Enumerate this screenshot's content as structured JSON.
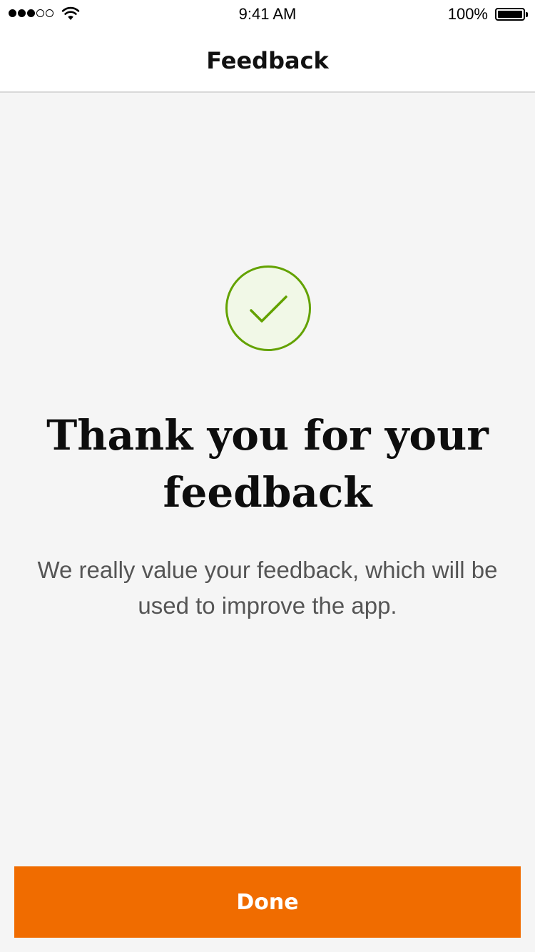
{
  "status_bar": {
    "time": "9:41 AM",
    "battery_percent": "100%",
    "signal_bars_filled": 3,
    "signal_bars_total": 5
  },
  "nav": {
    "title": "Feedback"
  },
  "confirmation": {
    "icon": "checkmark-icon",
    "headline": "Thank you for your feedback",
    "message": "We really value your feedback, which will be used to improve the app."
  },
  "actions": {
    "done_label": "Done"
  },
  "colors": {
    "accent": "#f06c00",
    "success": "#63a200",
    "success_bg": "#f1f8e7",
    "background": "#f5f5f5"
  }
}
